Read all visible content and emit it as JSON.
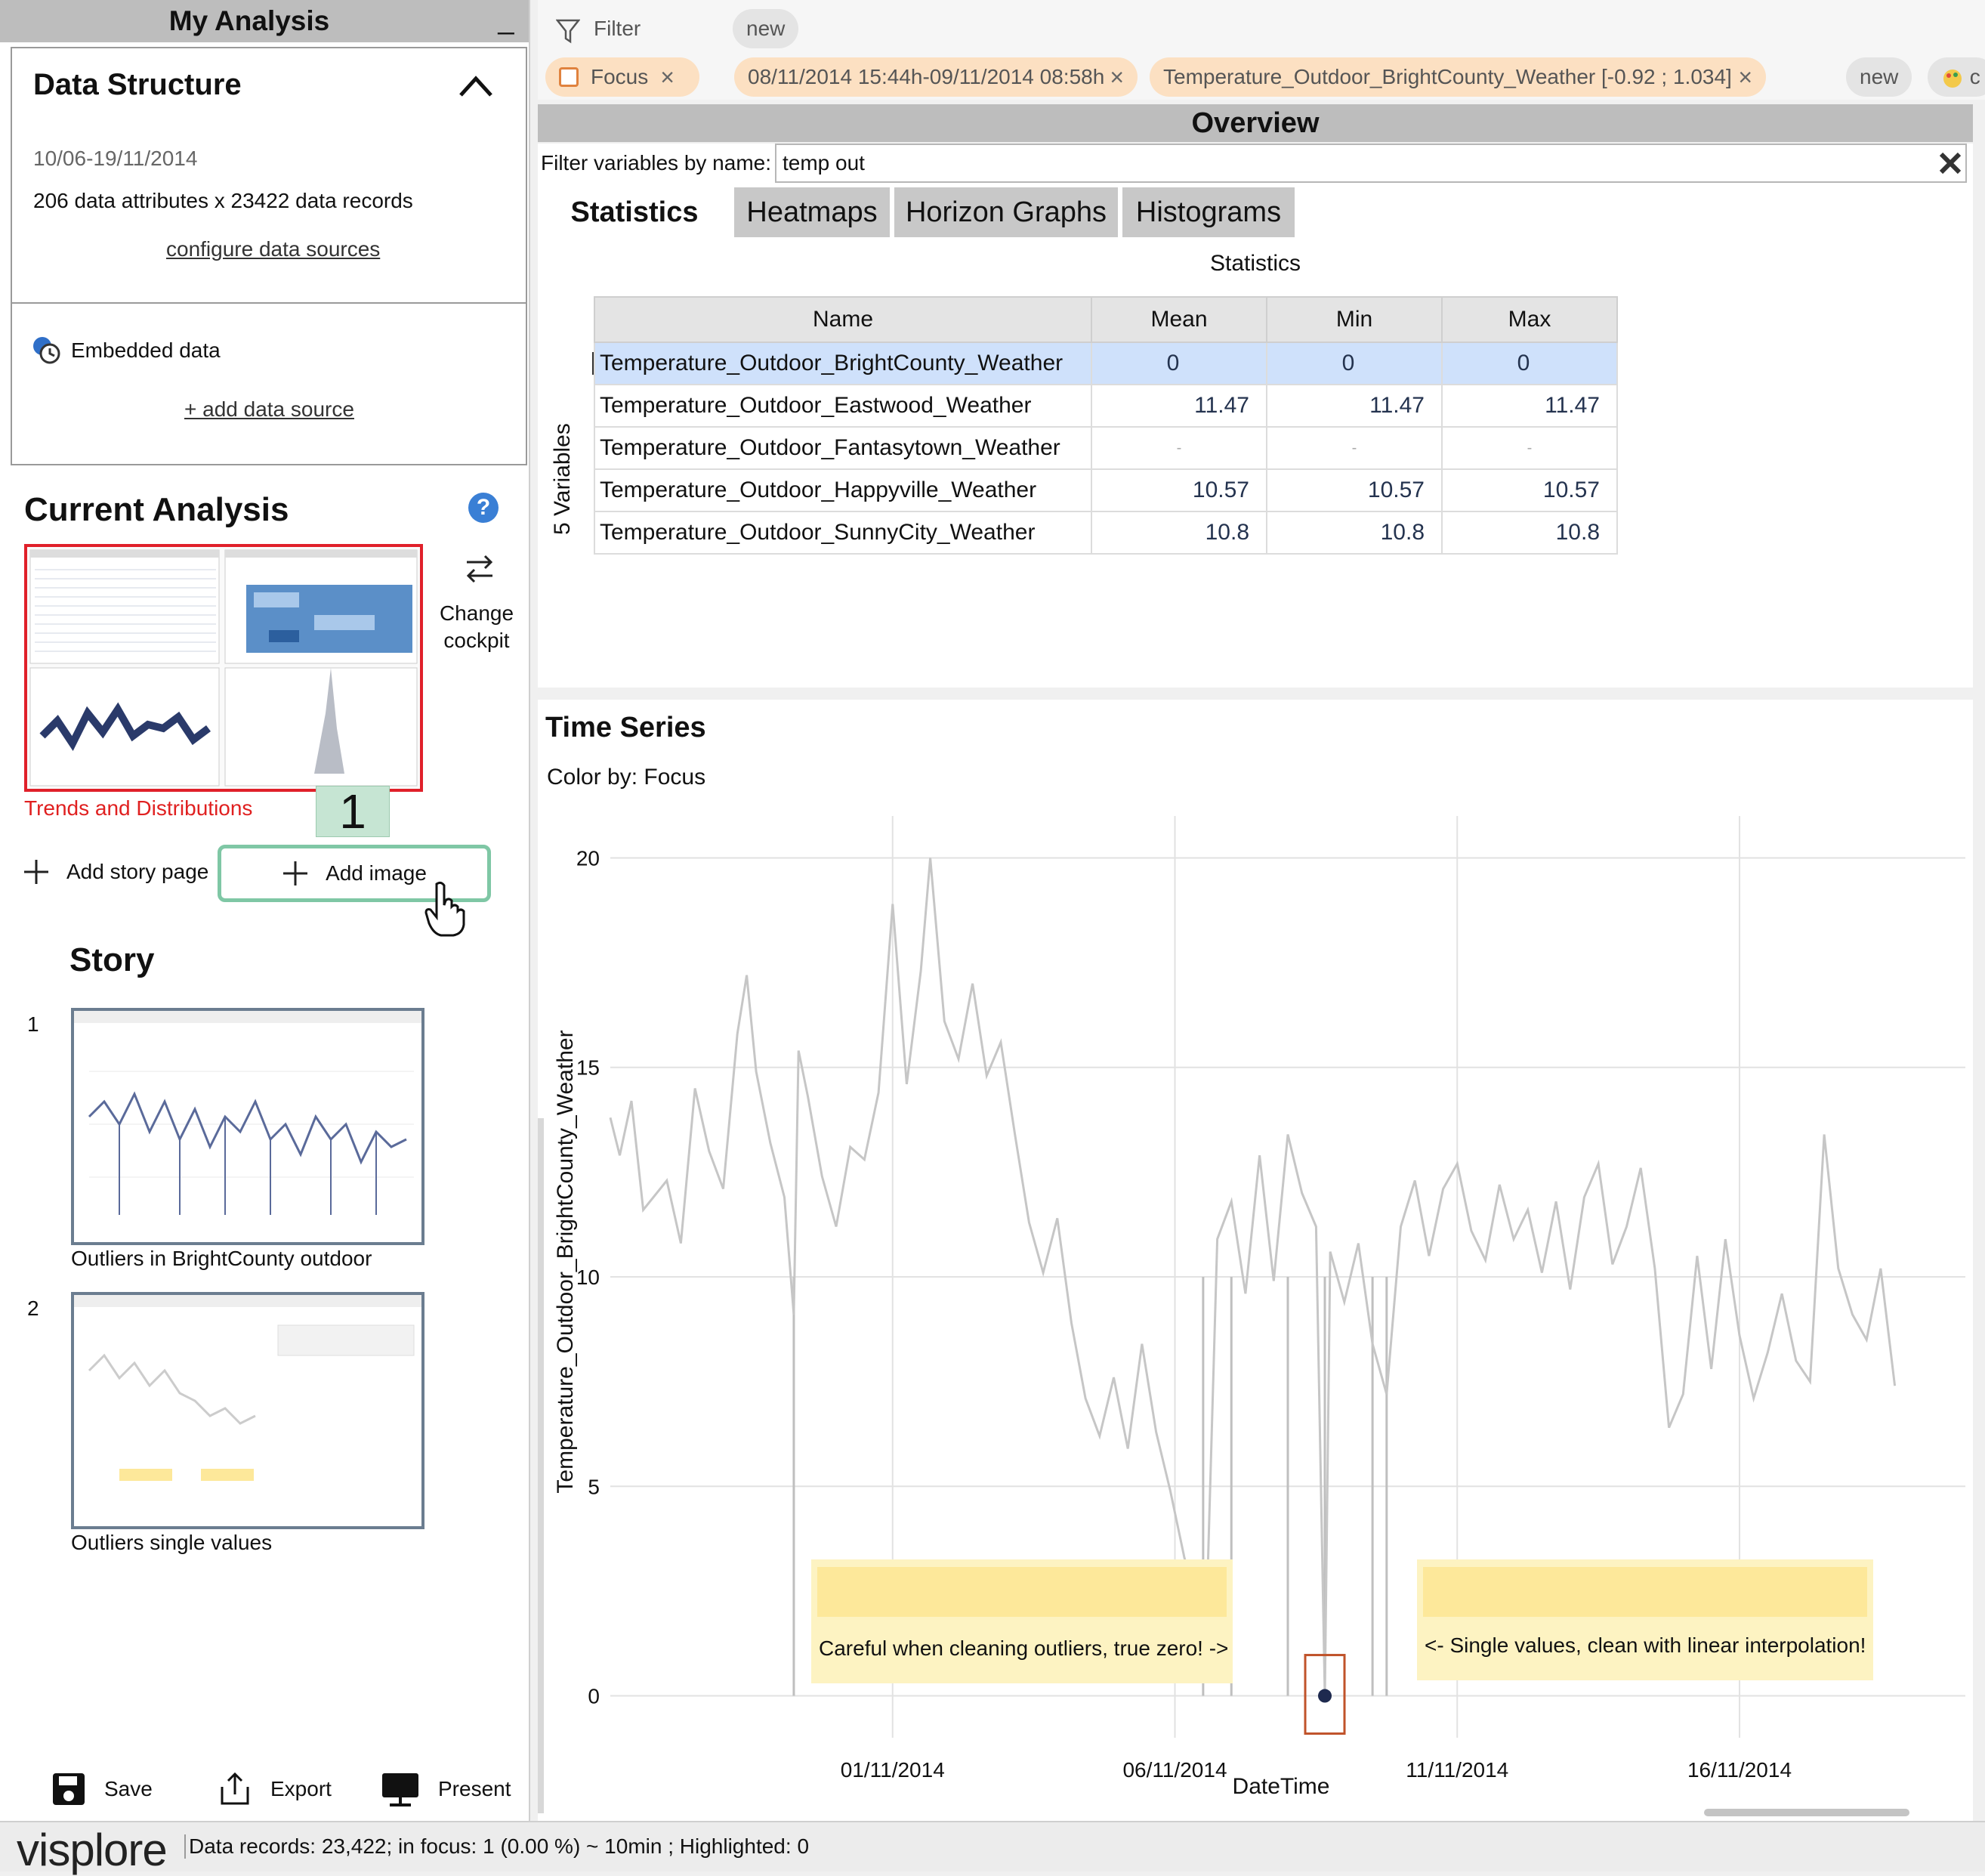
{
  "left_panel": {
    "title": "My Analysis",
    "minimize_label": "_",
    "data_structure": {
      "title": "Data Structure",
      "date_range": "10/06-19/11/2014",
      "records": "206 data attributes x 23422 data records",
      "configure_link": "configure data sources",
      "embedded_label": "Embedded data",
      "add_source_link": "+ add data source"
    },
    "current_analysis": {
      "title": "Current Analysis",
      "help_label": "?",
      "change_cockpit": "Change cockpit",
      "thumbnail_label": "Trends and Distributions",
      "page_number": "1",
      "add_story_page": "Add story page",
      "add_image": "Add image"
    },
    "story": {
      "title": "Story",
      "items": [
        {
          "number": "1",
          "label": "Outliers in BrightCounty outdoor"
        },
        {
          "number": "2",
          "label": "Outliers single values"
        }
      ]
    },
    "footer": {
      "save": "Save",
      "export": "Export",
      "present": "Present"
    }
  },
  "filter_bar": {
    "label": "Filter",
    "new_label": "new",
    "chips": [
      {
        "label": "Focus",
        "close": "×"
      },
      {
        "label": "08/11/2014 15:44h-09/11/2014 08:58h",
        "close": "×"
      },
      {
        "label": "Temperature_Outdoor_BrightCounty_Weather [-0.92 ; 1.034]",
        "close": "×"
      }
    ],
    "new_label_2": "new",
    "extra_chip": "c"
  },
  "overview": {
    "title": "Overview",
    "filter_label": "Filter variables by name:",
    "filter_value": "temp out",
    "tabs": [
      "Statistics",
      "Heatmaps",
      "Horizon Graphs",
      "Histograms"
    ],
    "statistics_title": "Statistics",
    "variables_label": "5 Variables",
    "columns": [
      "Name",
      "Mean",
      "Min",
      "Max"
    ],
    "rows": [
      {
        "name": "Temperature_Outdoor_BrightCounty_Weather",
        "mean": "0",
        "min": "0",
        "max": "0",
        "selected": true
      },
      {
        "name": "Temperature_Outdoor_Eastwood_Weather",
        "mean": "11.47",
        "min": "11.47",
        "max": "11.47"
      },
      {
        "name": "Temperature_Outdoor_Fantasytown_Weather",
        "mean": "-",
        "min": "-",
        "max": "-"
      },
      {
        "name": "Temperature_Outdoor_Happyville_Weather",
        "mean": "10.57",
        "min": "10.57",
        "max": "10.57"
      },
      {
        "name": "Temperature_Outdoor_SunnyCity_Weather",
        "mean": "10.8",
        "min": "10.8",
        "max": "10.8"
      }
    ]
  },
  "time_series": {
    "title": "Time Series",
    "color_by": "Color by: Focus",
    "notes": [
      "Careful when cleaning outliers, true zero! ->",
      "<- Single values, clean with linear interpolation!"
    ]
  },
  "chart_data": {
    "type": "line",
    "title": "",
    "xlabel": "DateTime",
    "ylabel": "Temperature_Outdoor_BrightCounty_Weather",
    "x_ticks": [
      "01/11/2014",
      "06/11/2014",
      "11/11/2014",
      "16/11/2014"
    ],
    "y_ticks": [
      0,
      5,
      10,
      15,
      20
    ],
    "xlim": [
      "27/10/2014",
      "20/11/2014"
    ],
    "ylim": [
      -1,
      21
    ],
    "grid": true,
    "series": [
      {
        "color": "#c6c6c6",
        "points": [
          [
            "27/10/2014 00:00",
            13.8
          ],
          [
            "27/10/2014 04:00",
            12.9
          ],
          [
            "27/10/2014 09:00",
            14.2
          ],
          [
            "27/10/2014 14:00",
            11.6
          ],
          [
            "28/10/2014 00:00",
            12.3
          ],
          [
            "28/10/2014 06:00",
            10.8
          ],
          [
            "28/10/2014 12:00",
            14.5
          ],
          [
            "28/10/2014 18:00",
            13.0
          ],
          [
            "29/10/2014 00:00",
            12.1
          ],
          [
            "29/10/2014 06:00",
            15.8
          ],
          [
            "29/10/2014 10:00",
            17.2
          ],
          [
            "29/10/2014 14:00",
            14.9
          ],
          [
            "29/10/2014 20:00",
            13.2
          ],
          [
            "30/10/2014 02:00",
            11.9
          ],
          [
            "30/10/2014 06:00",
            9.1
          ],
          [
            "30/10/2014 08:00",
            15.4
          ],
          [
            "30/10/2014 12:00",
            14.3
          ],
          [
            "30/10/2014 18:00",
            12.4
          ],
          [
            "31/10/2014 00:00",
            11.2
          ],
          [
            "31/10/2014 06:00",
            13.1
          ],
          [
            "31/10/2014 12:00",
            12.8
          ],
          [
            "31/10/2014 18:00",
            14.4
          ],
          [
            "01/11/2014 00:00",
            18.9
          ],
          [
            "01/11/2014 06:00",
            14.6
          ],
          [
            "01/11/2014 12:00",
            17.3
          ],
          [
            "01/11/2014 16:00",
            20.0
          ],
          [
            "01/11/2014 22:00",
            16.1
          ],
          [
            "02/11/2014 04:00",
            15.2
          ],
          [
            "02/11/2014 10:00",
            17.0
          ],
          [
            "02/11/2014 16:00",
            14.8
          ],
          [
            "02/11/2014 22:00",
            15.6
          ],
          [
            "03/11/2014 04:00",
            13.4
          ],
          [
            "03/11/2014 10:00",
            11.3
          ],
          [
            "03/11/2014 16:00",
            10.1
          ],
          [
            "03/11/2014 22:00",
            11.4
          ],
          [
            "04/11/2014 04:00",
            8.9
          ],
          [
            "04/11/2014 10:00",
            7.1
          ],
          [
            "04/11/2014 16:00",
            6.2
          ],
          [
            "04/11/2014 22:00",
            7.6
          ],
          [
            "05/11/2014 04:00",
            5.9
          ],
          [
            "05/11/2014 10:00",
            8.4
          ],
          [
            "05/11/2014 16:00",
            6.3
          ],
          [
            "05/11/2014 22:00",
            4.9
          ],
          [
            "06/11/2014 04:00",
            3.3
          ],
          [
            "06/11/2014 10:00",
            2.1
          ],
          [
            "06/11/2014 13:00",
            1.1
          ],
          [
            "06/11/2014 18:00",
            10.9
          ],
          [
            "07/11/2014 00:00",
            11.8
          ],
          [
            "07/11/2014 06:00",
            9.6
          ],
          [
            "07/11/2014 12:00",
            12.9
          ],
          [
            "07/11/2014 18:00",
            9.9
          ],
          [
            "08/11/2014 00:00",
            13.4
          ],
          [
            "08/11/2014 06:00",
            12.0
          ],
          [
            "08/11/2014 12:00",
            11.2
          ],
          [
            "08/11/2014 15:44",
            0.0
          ],
          [
            "08/11/2014 18:00",
            10.6
          ],
          [
            "09/11/2014 00:00",
            9.4
          ],
          [
            "09/11/2014 06:00",
            10.8
          ],
          [
            "09/11/2014 12:00",
            8.4
          ],
          [
            "09/11/2014 18:00",
            7.2
          ],
          [
            "10/11/2014 00:00",
            11.2
          ],
          [
            "10/11/2014 06:00",
            12.3
          ],
          [
            "10/11/2014 12:00",
            10.5
          ],
          [
            "10/11/2014 18:00",
            12.1
          ],
          [
            "11/11/2014 00:00",
            12.7
          ],
          [
            "11/11/2014 06:00",
            11.1
          ],
          [
            "11/11/2014 12:00",
            10.4
          ],
          [
            "11/11/2014 18:00",
            12.2
          ],
          [
            "12/11/2014 00:00",
            10.9
          ],
          [
            "12/11/2014 06:00",
            11.6
          ],
          [
            "12/11/2014 12:00",
            10.1
          ],
          [
            "12/11/2014 18:00",
            11.8
          ],
          [
            "13/11/2014 00:00",
            9.7
          ],
          [
            "13/11/2014 06:00",
            11.9
          ],
          [
            "13/11/2014 12:00",
            12.7
          ],
          [
            "13/11/2014 18:00",
            10.3
          ],
          [
            "14/11/2014 00:00",
            11.2
          ],
          [
            "14/11/2014 06:00",
            12.6
          ],
          [
            "14/11/2014 12:00",
            10.2
          ],
          [
            "14/11/2014 18:00",
            6.4
          ],
          [
            "15/11/2014 00:00",
            7.2
          ],
          [
            "15/11/2014 06:00",
            10.5
          ],
          [
            "15/11/2014 12:00",
            7.8
          ],
          [
            "15/11/2014 18:00",
            10.9
          ],
          [
            "16/11/2014 00:00",
            8.6
          ],
          [
            "16/11/2014 06:00",
            7.1
          ],
          [
            "16/11/2014 12:00",
            8.2
          ],
          [
            "16/11/2014 18:00",
            9.6
          ],
          [
            "17/11/2014 00:00",
            8.0
          ],
          [
            "17/11/2014 06:00",
            7.5
          ],
          [
            "17/11/2014 12:00",
            13.4
          ],
          [
            "17/11/2014 18:00",
            10.2
          ],
          [
            "18/11/2014 00:00",
            9.1
          ],
          [
            "18/11/2014 06:00",
            8.5
          ],
          [
            "18/11/2014 12:00",
            10.2
          ],
          [
            "18/11/2014 18:00",
            7.4
          ]
        ]
      }
    ],
    "vertical_dropouts": [
      "30/10/2014 06:00",
      "06/11/2014 12:00",
      "07/11/2014 00:00",
      "08/11/2014 00:00",
      "08/11/2014 15:44",
      "09/11/2014 12:00",
      "09/11/2014 18:00"
    ],
    "highlighted_point": {
      "x": "08/11/2014 15:44",
      "y": 0,
      "color": "#1e2a4f"
    }
  },
  "status": {
    "logo": "visplore",
    "text": "Data records: 23,422; in focus: 1 (0.00 %) ~ 10min ; Highlighted: 0"
  }
}
